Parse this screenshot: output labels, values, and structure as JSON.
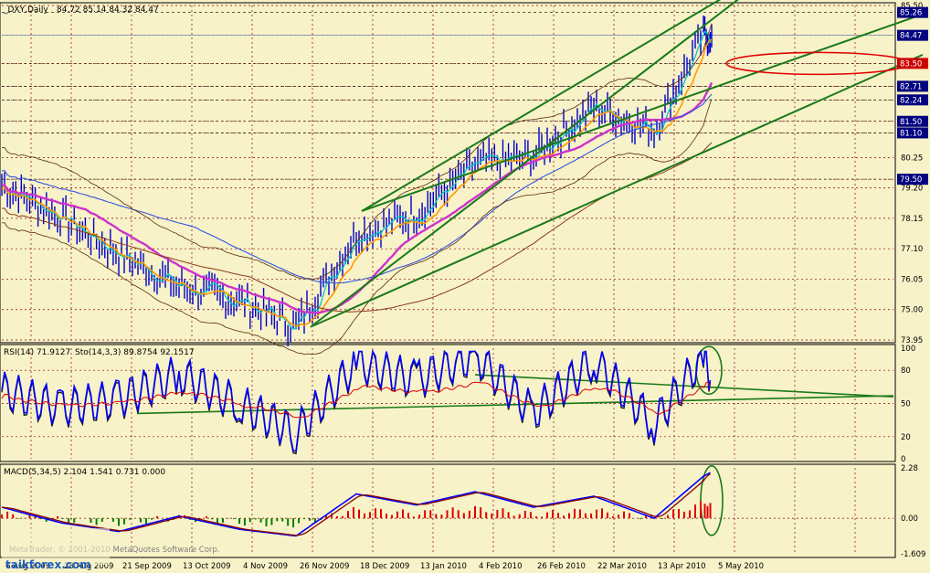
{
  "window": {
    "title": "_DXY,Daily",
    "ohlc": "84.72 85.14 84.32 84.47"
  },
  "panels": {
    "price": {
      "ticks": [
        "85.50",
        "84.47",
        "83.50",
        "82.71",
        "82.24",
        "81.50",
        "81.10",
        "80.25",
        "79.50",
        "79.20",
        "78.15",
        "77.10",
        "76.05",
        "75.00",
        "73.95"
      ],
      "highlighted_levels": [
        "85.26",
        "84.47",
        "83.50",
        "82.71",
        "82.24",
        "81.50",
        "81.10",
        "79.50"
      ],
      "current_price": "84.47"
    },
    "rsi": {
      "title": "RSI(14) 71.9127",
      "stoch_title": "Sto(14,3,3) 89.8754 92.1517",
      "ticks": [
        "100",
        "80",
        "50",
        "20",
        "0"
      ]
    },
    "macd": {
      "title": "MACD(5,34,5) 2.104 1.541 0.731 0.000",
      "ticks": [
        "2.28",
        "0.00",
        "-1.609"
      ]
    }
  },
  "x_axis": {
    "labels": [
      "6 Aug 2009",
      "28 Aug 2009",
      "21 Sep 2009",
      "13 Oct 2009",
      "4 Nov 2009",
      "26 Nov 2009",
      "18 Dec 2009",
      "13 Jan 2010",
      "4 Feb 2010",
      "26 Feb 2010",
      "22 Mar 2010",
      "13 Apr 2010",
      "5 May 2010"
    ]
  },
  "watermark": {
    "text": "MetaTrader, © 2001-2010 MetaQuotes Software Corp.",
    "logo": "taikforex.com"
  },
  "colors": {
    "background": "#f7f2c8",
    "price_line": "#0000cc",
    "ma_short": "#00c8c8",
    "ma_orange": "#ff9900",
    "ma_magenta": "#cc33cc",
    "ma_blue": "#3355dd",
    "ma_brown": "#8b3a1a",
    "trend_green": "#1a7a1a",
    "ellipse_red": "#e00000",
    "level_box": "#000080",
    "hist_red": "#e00000",
    "hist_green": "#008000"
  },
  "chart_data": {
    "type": "line",
    "title": "_DXY,Daily",
    "x": [
      "6 Aug 2009",
      "28 Aug 2009",
      "21 Sep 2009",
      "13 Oct 2009",
      "4 Nov 2009",
      "26 Nov 2009",
      "18 Dec 2009",
      "13 Jan 2010",
      "4 Feb 2010",
      "26 Feb 2010",
      "22 Mar 2010",
      "13 Apr 2010",
      "5 May 2010",
      "7 May 2010"
    ],
    "series": [
      {
        "values": [
          79.3,
          78.2,
          76.9,
          75.8,
          75.3,
          74.4,
          77.6,
          78.3,
          80.0,
          80.3,
          82.0,
          81.2,
          84.5,
          84.47
        ]
      }
    ],
    "ylim": [
      73.95,
      85.5
    ],
    "rsi": [
      60,
      45,
      52,
      75,
      48,
      22,
      85,
      70,
      92,
      40,
      88,
      30,
      92,
      72
    ],
    "rsi_ylim": [
      0,
      100
    ],
    "macd": [
      0.5,
      -0.2,
      -0.6,
      0.1,
      -0.5,
      -0.8,
      1.1,
      0.6,
      1.2,
      0.5,
      1.0,
      0.0,
      1.9,
      2.1
    ],
    "macd_ylim": [
      -1.609,
      2.28
    ],
    "current_price": 84.47
  }
}
